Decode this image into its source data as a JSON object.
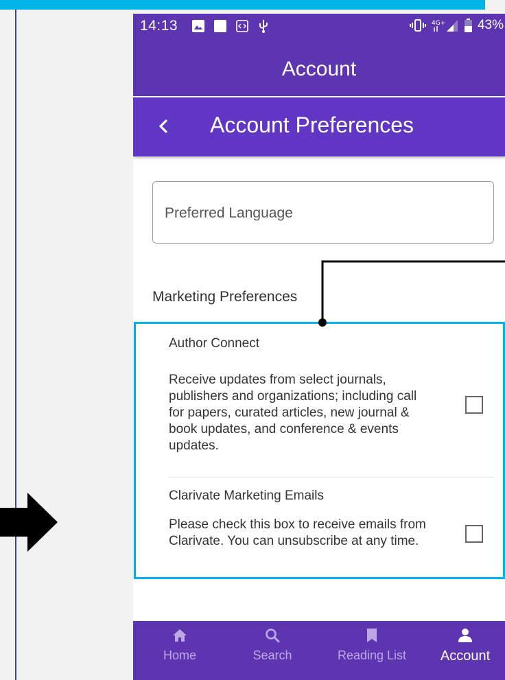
{
  "status_bar": {
    "time": "14:13",
    "battery": "43%",
    "icons": [
      "image-icon",
      "square-icon",
      "code-icon",
      "usb-icon",
      "vibrate-icon",
      "lte-signal-icon",
      "battery-icon"
    ]
  },
  "app_bar": {
    "title": "Account"
  },
  "sub_bar": {
    "title": "Account Preferences",
    "back_icon": "chevron-left-icon"
  },
  "language_field": {
    "placeholder": "Preferred Language",
    "value": ""
  },
  "marketing": {
    "heading": "Marketing Preferences",
    "options": [
      {
        "title": "Author Connect",
        "description_lines": [
          "Receive updates from select journals,",
          "publishers and organizations; including call",
          "for papers, curated articles, new journal &",
          "book updates, and conference & events",
          "updates."
        ],
        "checked": false
      },
      {
        "title": "Clarivate Marketing Emails",
        "description_lines": [
          "Please check this box to receive emails from",
          "Clarivate. You can unsubscribe at any time."
        ],
        "checked": false
      }
    ]
  },
  "bottom_nav": {
    "items": [
      {
        "label": "Home",
        "icon": "home-icon",
        "active": false
      },
      {
        "label": "Search",
        "icon": "search-icon",
        "active": false
      },
      {
        "label": "Reading List",
        "icon": "bookmark-icon",
        "active": false
      },
      {
        "label": "Account",
        "icon": "person-icon",
        "active": true
      }
    ]
  },
  "colors": {
    "primary": "#5e35b1",
    "highlight": "#00b4e8",
    "annotation": "#000000"
  }
}
